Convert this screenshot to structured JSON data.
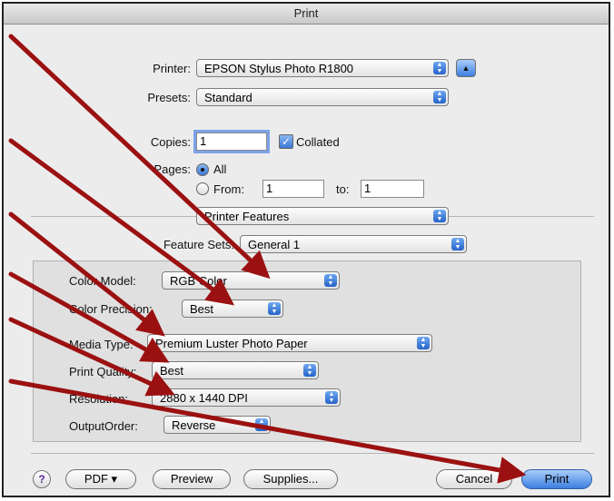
{
  "window": {
    "title": "Print"
  },
  "printer": {
    "label": "Printer:",
    "value": "EPSON Stylus Photo R1800"
  },
  "presets": {
    "label": "Presets:",
    "value": "Standard"
  },
  "copies": {
    "label": "Copies:",
    "value": "1",
    "collated_label": "Collated",
    "collated_checked": true
  },
  "pages": {
    "label": "Pages:",
    "all_label": "All",
    "from_label": "From:",
    "from_value": "1",
    "to_label": "to:",
    "to_value": "1",
    "selected": "All"
  },
  "section_popup": {
    "value": "Printer Features"
  },
  "feature_sets": {
    "label": "Feature Sets:",
    "value": "General 1"
  },
  "settings": [
    {
      "label": "Color Model:",
      "value": "RGB Color"
    },
    {
      "label": "Color Precision:",
      "value": "Best"
    },
    {
      "label": "Media Type:",
      "value": "Premium Luster Photo Paper"
    },
    {
      "label": "Print Quality:",
      "value": "Best"
    },
    {
      "label": "Resolution:",
      "value": "2880 x 1440 DPI"
    },
    {
      "label": "OutputOrder:",
      "value": "Reverse"
    }
  ],
  "footer": {
    "help": "?",
    "pdf": "PDF ▾",
    "preview": "Preview",
    "supplies": "Supplies...",
    "cancel": "Cancel",
    "print": "Print"
  },
  "colors": {
    "annotation_arrow": "#9b1111",
    "default_button": "#3d7fe0"
  }
}
